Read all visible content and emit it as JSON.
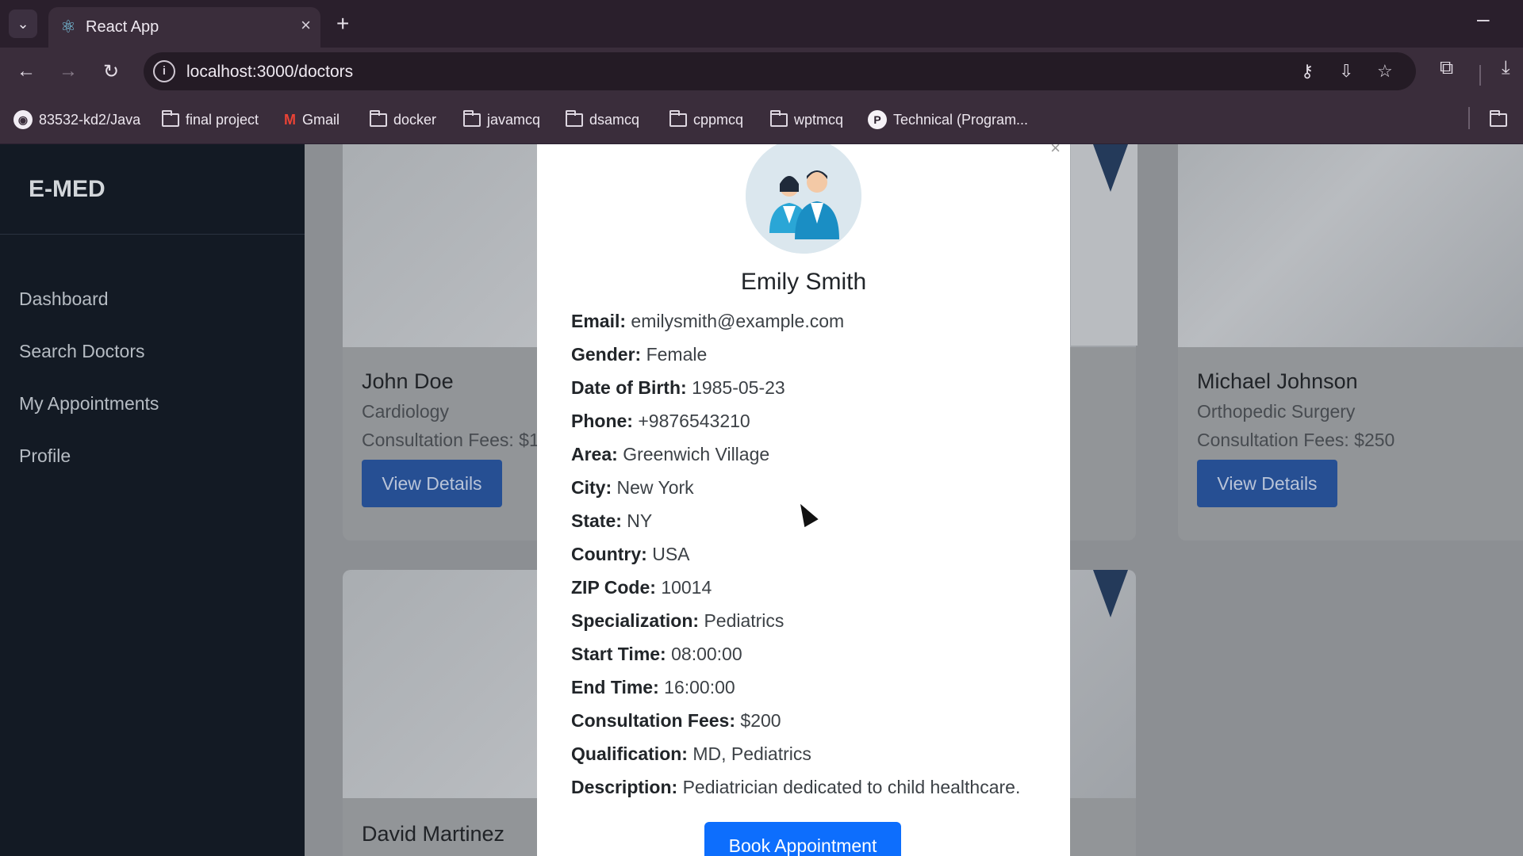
{
  "browser": {
    "tab_title": "React App",
    "url": "localhost:3000/doctors",
    "bookmarks": [
      "83532-kd2/Java",
      "final project",
      "Gmail",
      "docker",
      "javamcq",
      "dsamcq",
      "cppmcq",
      "wptmcq",
      "Technical (Program..."
    ]
  },
  "sidebar": {
    "brand": "E-MED",
    "items": [
      "Dashboard",
      "Search Doctors",
      "My Appointments",
      "Profile"
    ]
  },
  "cards": [
    {
      "name": "John Doe",
      "specialization": "Cardiology",
      "fees": "Consultation Fees: $1",
      "button": "View Details"
    },
    {
      "name": "Michael Johnson",
      "specialization": "Orthopedic Surgery",
      "fees": "Consultation Fees: $250",
      "button": "View Details"
    },
    {
      "name": "David Martinez"
    }
  ],
  "modal": {
    "name": "Emily Smith",
    "details": [
      {
        "label": "Email:",
        "value": "emilysmith@example.com"
      },
      {
        "label": "Gender:",
        "value": "Female"
      },
      {
        "label": "Date of Birth:",
        "value": "1985-05-23"
      },
      {
        "label": "Phone:",
        "value": "+9876543210"
      },
      {
        "label": "Area:",
        "value": "Greenwich Village"
      },
      {
        "label": "City:",
        "value": "New York"
      },
      {
        "label": "State:",
        "value": "NY"
      },
      {
        "label": "Country:",
        "value": "USA"
      },
      {
        "label": "ZIP Code:",
        "value": "10014"
      },
      {
        "label": "Specialization:",
        "value": "Pediatrics"
      },
      {
        "label": "Start Time:",
        "value": "08:00:00"
      },
      {
        "label": "End Time:",
        "value": "16:00:00"
      },
      {
        "label": "Consultation Fees:",
        "value": "$200"
      },
      {
        "label": "Qualification:",
        "value": "MD, Pediatrics"
      },
      {
        "label": "Description:",
        "value": "Pediatrician dedicated to child healthcare."
      }
    ],
    "book_button": "Book Appointment"
  }
}
